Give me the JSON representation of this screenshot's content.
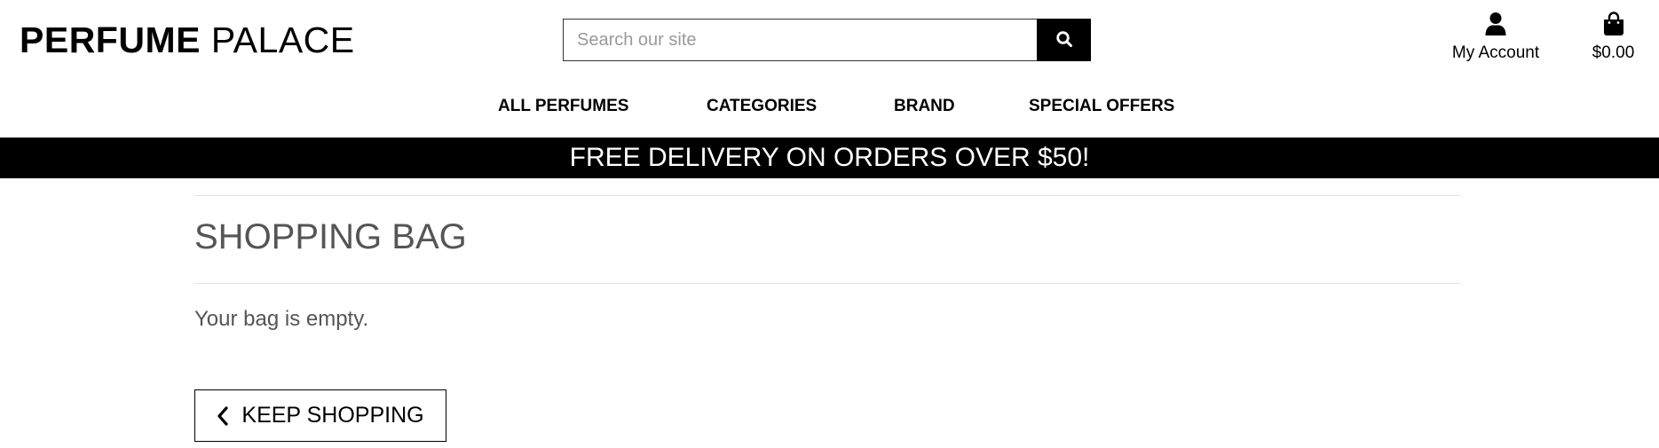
{
  "header": {
    "logo_bold": "PERFUME",
    "logo_light": "PALACE",
    "search": {
      "placeholder": "Search our site",
      "value": ""
    },
    "account_label": "My Account",
    "bag_total": "$0.00"
  },
  "nav": {
    "items": [
      "ALL PERFUMES",
      "CATEGORIES",
      "BRAND",
      "SPECIAL OFFERS"
    ]
  },
  "banner": {
    "text": "FREE DELIVERY ON ORDERS OVER $50!"
  },
  "main": {
    "title": "SHOPPING BAG",
    "empty_message": "Your bag is empty.",
    "keep_shopping_label": "KEEP SHOPPING"
  },
  "icons": {
    "search": "search-icon",
    "account": "user-icon",
    "bag": "shopping-bag-icon",
    "back": "chevron-left-icon"
  },
  "colors": {
    "banner_bg": "#000000",
    "banner_text": "#ffffff",
    "heading_text": "#555555",
    "search_button_bg": "#000000"
  }
}
